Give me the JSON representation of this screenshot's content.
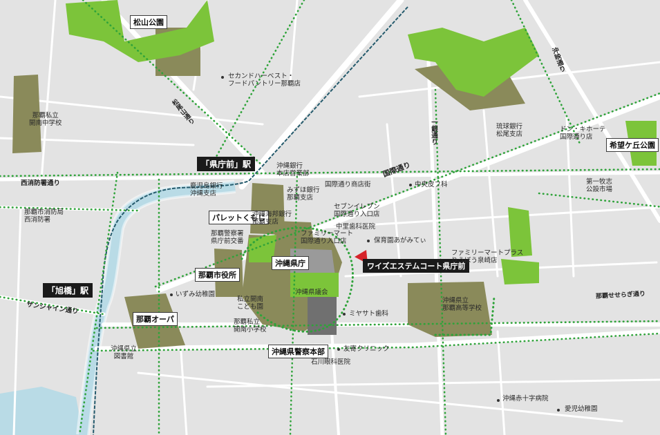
{
  "colors": {
    "background": "#e3e3e3",
    "roads": "#ffffff",
    "building": "#8a8a5a",
    "green": "#7cc43a",
    "water": "#b9dbe6",
    "monorail": "#245a6c",
    "dotted_route": "#2fa33a",
    "target_marker": "#d6232a"
  },
  "stations": {
    "kenchomae": "「県庁前」駅",
    "asahibashi": "「旭橋」駅"
  },
  "target": "ワイズエステムコート県庁前",
  "boxed_labels": {
    "matsuyama_park": "松山公園",
    "nozomigaoka_park": "希望ケ丘公園",
    "naha_opa": "那覇オーパ",
    "naha_city_hall": "那覇市役所",
    "okinawa_pref_office": "沖縄県庁",
    "pallet_kumoji": "パレットくもじ",
    "police_hq": "沖縄県警察本部"
  },
  "roads": {
    "kokusai": "国際通り",
    "nishi_shobosho": "西消防署通り",
    "sunshine": "サンシャイン通り",
    "naha_seseragi": "那覇せせらぎ通り",
    "okinawa_dori": "沖映通り",
    "ichigin": "一銀通り",
    "matsuyama_dori": "松尾山通り"
  },
  "poi": {
    "second_harvest": "セカンドハーベスト・\nフードパントリー那覇店",
    "naha_private_jhs": "那覇私立\n開南中学校",
    "okigin_honten": "沖縄銀行\n本店営業部",
    "kagoshima_bank": "鹿児島銀行\n沖縄支店",
    "okinawa_kaiho_bank": "みずほ銀行\n那覇支店",
    "kokusai_shotengai": "国際通り商店街",
    "chuo_clinic": "中央皮フ科",
    "ryugin_matsuo": "琉球銀行\n松尾支店",
    "donki": "ドン・キホーテ\n国際通り店",
    "daiichi_makishi": "第一牧志\n公設市場",
    "fire_station": "那覇市消防局\n西消防署",
    "okinawa_kaiho_bank2": "沖縄海邦銀行\n那覇支店",
    "police_annex": "那覇警察署\n県庁前交番",
    "seven_eleven": "セブンイレブン\n国際通り入口店",
    "familymart_kokusai": "ファミリーマート\n国際通り入口店",
    "nakazato_dental": "中里歯科医院",
    "hoikuen": "保育園あがみてぃ",
    "familymart_plus": "ファミリーマートプラス\nりうぼう泉崎店",
    "izumi_kindergarten": "いずみ幼稚園",
    "private_kaiho_kinder": "私立開南\nこども園",
    "naha_private_kaiho_es": "那覇私立\n開南小学校",
    "okinawa_pref_assembly": "沖縄県議会",
    "miyasato_dental": "ミヤサト歯科",
    "tomoyose_clinic": "友寄クリニック",
    "ishikawa_eye": "石川眼科医院",
    "naha_high_school": "沖縄県立\n那覇高等学校",
    "library": "沖縄県立\n図書館",
    "red_cross": "沖縄赤十字病院",
    "aiji_kinder": "愛児幼稚園"
  }
}
